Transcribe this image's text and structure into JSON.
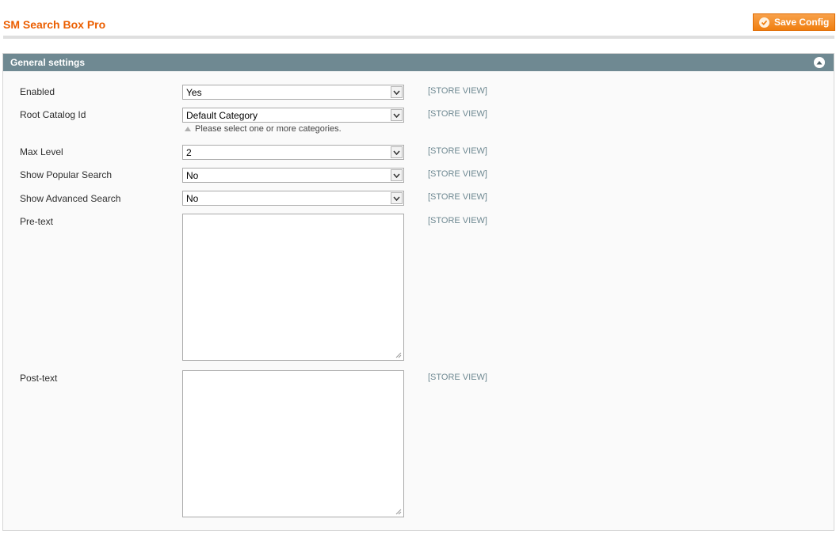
{
  "header": {
    "title": "SM Search Box Pro",
    "save_label": "Save Config"
  },
  "section": {
    "title": "General settings",
    "collapse_icon": "collapse-up-icon"
  },
  "fields": {
    "enabled": {
      "label": "Enabled",
      "value": "Yes",
      "scope": "[STORE VIEW]"
    },
    "root_catalog": {
      "label": "Root Catalog Id",
      "value": "Default Category",
      "scope": "[STORE VIEW]",
      "note": "Please select one or more categories."
    },
    "max_level": {
      "label": "Max Level",
      "value": "2",
      "scope": "[STORE VIEW]"
    },
    "show_popular": {
      "label": "Show Popular Search",
      "value": "No",
      "scope": "[STORE VIEW]"
    },
    "show_advanced": {
      "label": "Show Advanced Search",
      "value": "No",
      "scope": "[STORE VIEW]"
    },
    "pre_text": {
      "label": "Pre-text",
      "value": "",
      "scope": "[STORE VIEW]"
    },
    "post_text": {
      "label": "Post-text",
      "value": "",
      "scope": "[STORE VIEW]"
    }
  },
  "colors": {
    "accent": "#eb5e00",
    "button": "#f07f10",
    "section_header": "#6f8992"
  }
}
